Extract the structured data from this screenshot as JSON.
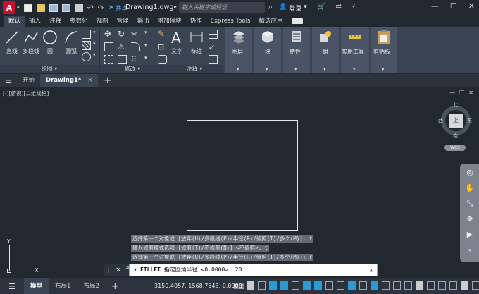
{
  "titlebar": {
    "logo": "A",
    "share_label": "共享",
    "doc_title": "Drawing1.dwg",
    "search_placeholder": "键入关键字或短语",
    "login_label": "登录",
    "help_label": "?"
  },
  "ribbon_tabs": [
    "默认",
    "插入",
    "注释",
    "参数化",
    "视图",
    "管理",
    "输出",
    "附加模块",
    "协作",
    "Express Tools",
    "精选应用"
  ],
  "ribbon": {
    "draw_buttons": [
      "直线",
      "多段线",
      "圆",
      "圆弧"
    ],
    "draw_panel": "绘图",
    "modify_panel": "修改",
    "annot_buttons": [
      "文字",
      "标注"
    ],
    "annot_panel": "注释",
    "tiles": [
      "图层",
      "块",
      "特性",
      "组",
      "实用工具",
      "剪贴板"
    ]
  },
  "doc_tabs": {
    "start": "开始",
    "active": "Drawing1*",
    "close": "×"
  },
  "viewport": {
    "label": "[-][俯视][二维线框]",
    "viewcube_top": "上",
    "north": "北",
    "south": "南",
    "east": "东",
    "west": "西",
    "wcs": "WCS"
  },
  "ucs": {
    "x": "X",
    "y": "Y"
  },
  "command_history": [
    "选择第一个对象或 [放弃(U)/多段线(P)/半径(R)/修剪(T)/多个(M)]: t",
    "输入修剪模式选项 [修剪(T)/不修剪(N)] <不修剪>: t",
    "选择第一个对象或 [放弃(U)/多段线(P)/半径(R)/修剪(T)/多个(M)]: r"
  ],
  "command_line": {
    "command": "FILLET",
    "prompt": "指定圆角半径 <0.0000>:",
    "value": "20"
  },
  "statusbar": {
    "tabs": [
      "模型",
      "布局1",
      "布局2"
    ],
    "coords": "3150.4057, 1568.7543, 0.0000",
    "space": "模型"
  },
  "colors": {
    "background": "#212830",
    "ribbon": "#3b4453",
    "accent": "#2a9bd6",
    "logo": "#c8102e"
  }
}
